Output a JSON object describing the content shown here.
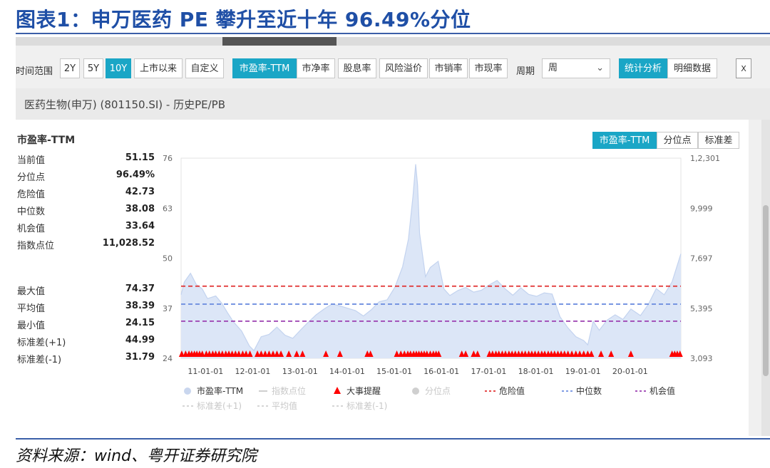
{
  "figure": {
    "title": "图表1：申万医药 PE 攀升至近十年 96.49%分位",
    "source": "资料来源：wind、粤开证券研究院"
  },
  "toolbar": {
    "time_range_label": "时间范围",
    "ranges": [
      "2Y",
      "5Y",
      "10Y",
      "上市以来",
      "自定义"
    ],
    "active_range": "10Y",
    "metrics": [
      "市盈率-TTM",
      "市净率",
      "股息率",
      "风险溢价",
      "市销率",
      "市现率"
    ],
    "active_metric": "市盈率-TTM",
    "period_label": "周期",
    "period_value": "周",
    "view_tabs": [
      "统计分析",
      "明细数据"
    ],
    "active_view": "统计分析",
    "export_icon": "excel-export-icon"
  },
  "subheader": {
    "text": "医药生物(申万) (801150.SI) - 历史PE/PB"
  },
  "stats": {
    "title": "市盈率-TTM",
    "rows_top": [
      {
        "label": "当前值",
        "value": "51.15"
      },
      {
        "label": "分位点",
        "value": "96.49%"
      },
      {
        "label": "危险值",
        "value": "42.73"
      },
      {
        "label": "中位数",
        "value": "38.08"
      },
      {
        "label": "机会值",
        "value": "33.64"
      },
      {
        "label": "指数点位",
        "value": "11,028.52"
      }
    ],
    "rows_bottom": [
      {
        "label": "最大值",
        "value": "74.37"
      },
      {
        "label": "平均值",
        "value": "38.39"
      },
      {
        "label": "最小值",
        "value": "24.15"
      },
      {
        "label": "标准差(+1)",
        "value": "44.99"
      },
      {
        "label": "标准差(-1)",
        "value": "31.79"
      }
    ]
  },
  "chart_tabs": [
    "市盈率-TTM",
    "分位点",
    "标准差"
  ],
  "active_chart_tab": "市盈率-TTM",
  "colors": {
    "accent": "#1aa6c6",
    "area_fill": "#dce6f7",
    "area_line": "#c3d3ef",
    "danger": "#e03030",
    "median": "#6f8fe0",
    "opportunity": "#9b3fb0",
    "event": "#ff0000"
  },
  "chart_data": {
    "type": "area",
    "title": "",
    "y_left_ticks": [
      "76",
      "63",
      "50",
      "37",
      "24"
    ],
    "y_left_range": [
      24,
      76
    ],
    "y_right_ticks": [
      "1,2,301",
      "9,999",
      "7,697",
      "5,395",
      "3,093"
    ],
    "x_ticks": [
      "11-01-01",
      "12-01-01",
      "13-01-01",
      "14-01-01",
      "15-01-01",
      "16-01-01",
      "17-01-01",
      "18-01-01",
      "19-01-01",
      "20-01-01"
    ],
    "x_range": [
      "2010-06-20",
      "2021-01-22"
    ],
    "series": [
      {
        "name": "市盈率-TTM",
        "points": [
          [
            "2010-06-20",
            40.5
          ],
          [
            "2010-07-15",
            43.8
          ],
          [
            "2010-09-01",
            46.1
          ],
          [
            "2010-10-15",
            43.2
          ],
          [
            "2010-12-01",
            42.0
          ],
          [
            "2011-01-10",
            39.5
          ],
          [
            "2011-03-15",
            40.2
          ],
          [
            "2011-05-01",
            38.3
          ],
          [
            "2011-06-15",
            35.8
          ],
          [
            "2011-08-01",
            33.4
          ],
          [
            "2011-10-01",
            31.1
          ],
          [
            "2011-12-01",
            27.2
          ],
          [
            "2012-01-05",
            26.0
          ],
          [
            "2012-03-01",
            29.6
          ],
          [
            "2012-05-01",
            30.2
          ],
          [
            "2012-07-01",
            32.1
          ],
          [
            "2012-09-01",
            30.0
          ],
          [
            "2012-11-01",
            29.2
          ],
          [
            "2013-01-01",
            31.4
          ],
          [
            "2013-03-01",
            33.4
          ],
          [
            "2013-05-01",
            35.3
          ],
          [
            "2013-07-01",
            36.8
          ],
          [
            "2013-09-01",
            38.1
          ],
          [
            "2013-11-01",
            37.6
          ],
          [
            "2014-01-01",
            37.0
          ],
          [
            "2014-03-01",
            36.4
          ],
          [
            "2014-05-01",
            35.0
          ],
          [
            "2014-07-01",
            36.6
          ],
          [
            "2014-09-01",
            38.7
          ],
          [
            "2014-11-01",
            39.2
          ],
          [
            "2015-01-01",
            42.5
          ],
          [
            "2015-03-01",
            47.8
          ],
          [
            "2015-04-15",
            55.0
          ],
          [
            "2015-05-20",
            66.0
          ],
          [
            "2015-06-10",
            74.4
          ],
          [
            "2015-06-25",
            69.0
          ],
          [
            "2015-07-10",
            56.5
          ],
          [
            "2015-08-25",
            45.2
          ],
          [
            "2015-10-01",
            47.6
          ],
          [
            "2015-12-01",
            49.2
          ],
          [
            "2016-01-15",
            42.0
          ],
          [
            "2016-03-01",
            40.3
          ],
          [
            "2016-05-01",
            41.6
          ],
          [
            "2016-07-01",
            42.4
          ],
          [
            "2016-09-01",
            41.2
          ],
          [
            "2016-11-01",
            41.7
          ],
          [
            "2017-01-01",
            43.1
          ],
          [
            "2017-03-01",
            44.2
          ],
          [
            "2017-05-01",
            42.1
          ],
          [
            "2017-07-01",
            40.4
          ],
          [
            "2017-09-01",
            42.3
          ],
          [
            "2017-11-01",
            40.6
          ],
          [
            "2018-01-01",
            40.1
          ],
          [
            "2018-03-01",
            41.0
          ],
          [
            "2018-05-01",
            40.7
          ],
          [
            "2018-07-01",
            34.8
          ],
          [
            "2018-09-01",
            31.9
          ],
          [
            "2018-11-01",
            29.6
          ],
          [
            "2019-01-01",
            28.6
          ],
          [
            "2019-02-01",
            27.5
          ],
          [
            "2019-03-15",
            33.6
          ],
          [
            "2019-05-01",
            31.3
          ],
          [
            "2019-07-01",
            33.9
          ],
          [
            "2019-09-01",
            35.3
          ],
          [
            "2019-11-01",
            34.1
          ],
          [
            "2020-01-01",
            36.8
          ],
          [
            "2020-03-15",
            35.1
          ],
          [
            "2020-05-15",
            38.0
          ],
          [
            "2020-07-15",
            42.1
          ],
          [
            "2020-09-15",
            40.5
          ],
          [
            "2020-11-15",
            43.9
          ],
          [
            "2021-01-22",
            51.15
          ]
        ]
      }
    ],
    "reference_lines": [
      {
        "name": "危险值",
        "value": 42.73
      },
      {
        "name": "中位数",
        "value": 38.08
      },
      {
        "name": "机会值",
        "value": 33.64
      }
    ],
    "event_markers": {
      "name": "大事提醒",
      "dates": [
        "2010-06-25",
        "2010-07-25",
        "2010-08-20",
        "2010-09-10",
        "2010-10-01",
        "2010-10-20",
        "2010-11-10",
        "2010-12-01",
        "2011-01-01",
        "2011-01-25",
        "2011-02-20",
        "2011-03-15",
        "2011-04-10",
        "2011-05-05",
        "2011-06-01",
        "2011-06-25",
        "2011-07-20",
        "2011-08-15",
        "2011-09-10",
        "2011-10-10",
        "2011-11-05",
        "2011-12-05",
        "2012-02-01",
        "2012-03-01",
        "2012-04-01",
        "2012-05-01",
        "2012-06-01",
        "2012-07-01",
        "2012-08-01",
        "2012-10-01",
        "2012-12-01",
        "2013-01-15",
        "2013-07-15",
        "2013-11-01",
        "2014-06-01",
        "2014-06-25",
        "2015-01-15",
        "2015-02-15",
        "2015-03-15",
        "2015-04-10",
        "2015-05-01",
        "2015-05-25",
        "2015-06-15",
        "2015-07-05",
        "2015-07-25",
        "2015-08-15",
        "2015-09-05",
        "2015-10-01",
        "2015-10-25",
        "2015-11-15",
        "2015-12-05",
        "2016-06-01",
        "2016-07-01",
        "2016-09-01",
        "2016-10-01",
        "2017-01-01",
        "2017-01-25",
        "2017-02-20",
        "2017-03-15",
        "2017-04-10",
        "2017-05-05",
        "2017-06-01",
        "2017-06-25",
        "2017-07-20",
        "2017-08-15",
        "2017-09-10",
        "2017-10-05",
        "2017-11-01",
        "2017-11-25",
        "2017-12-20",
        "2018-01-15",
        "2018-02-10",
        "2018-03-05",
        "2018-04-01",
        "2018-04-25",
        "2018-05-20",
        "2018-06-15",
        "2018-07-10",
        "2018-08-05",
        "2018-09-01",
        "2018-10-01",
        "2018-11-01",
        "2018-12-01",
        "2019-01-01",
        "2019-02-01",
        "2019-03-01",
        "2019-05-15",
        "2019-08-01",
        "2020-01-01",
        "2020-11-15",
        "2020-12-05",
        "2020-12-25",
        "2021-01-15"
      ]
    },
    "legend": [
      {
        "label": "市盈率-TTM",
        "kind": "dot-fill",
        "muted": false
      },
      {
        "label": "指数点位",
        "kind": "line",
        "muted": true
      },
      {
        "label": "大事提醒",
        "kind": "triangle",
        "muted": false
      },
      {
        "label": "分位点",
        "kind": "dot",
        "muted": true
      },
      {
        "label": "危险值",
        "kind": "dash-danger",
        "muted": false
      },
      {
        "label": "中位数",
        "kind": "dash-median",
        "muted": false
      },
      {
        "label": "机会值",
        "kind": "dash-opportunity",
        "muted": false
      },
      {
        "label": "标准差(+1)",
        "kind": "dash-muted",
        "muted": true
      },
      {
        "label": "平均值",
        "kind": "dash-muted",
        "muted": true
      },
      {
        "label": "标准差(-1)",
        "kind": "dash-muted",
        "muted": true
      }
    ]
  }
}
